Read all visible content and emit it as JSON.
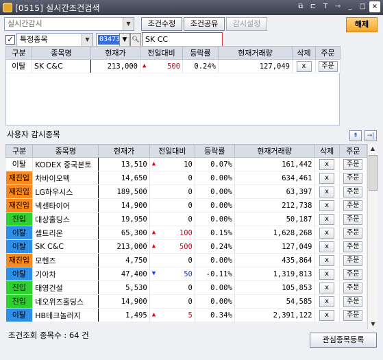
{
  "window": {
    "title": "[0515] 실시간조건검색",
    "controls": [
      "copy-icon",
      "new-window-icon",
      "text-icon",
      "pin-icon",
      "minimize-icon",
      "maximize-icon",
      "close-icon"
    ]
  },
  "toolbar": {
    "condition_select": "실시간감시",
    "edit_condition": "조건수정",
    "share_condition": "조건공유",
    "monitor_settings": "감시설정",
    "release": "해제",
    "stock_scope_select": "특정종목",
    "stock_code": "034730",
    "stock_name": "SK CC",
    "colors": {
      "release_button": "#f5a623",
      "stock_name_border": "#e0384a"
    }
  },
  "grid_headers": [
    "구분",
    "종목명",
    "현재가",
    "전일대비",
    "등락률",
    "현재거래량",
    "삭제",
    "주문"
  ],
  "top_rows": [
    {
      "type": "이탈",
      "tag": "plain",
      "name": "SK C&C",
      "price": "213,000",
      "dir": "up",
      "diff": "500",
      "rate": "0.24%",
      "volume": "127,049",
      "delete": "x",
      "order": "주문"
    }
  ],
  "watch": {
    "label": "사용자 감시종목",
    "rows": [
      {
        "type": "이탈",
        "tag": "plain",
        "name": "KODEX 중국본토",
        "price": "13,510",
        "dir": "up-plain",
        "diff": "10",
        "rate": "0.07%",
        "volume": "161,442",
        "delete": "x",
        "order": "주문"
      },
      {
        "type": "재진입",
        "tag": "reentry",
        "name": "차바이오텍",
        "price": "14,650",
        "dir": "",
        "diff": "0",
        "rate": "0.00%",
        "volume": "634,461",
        "delete": "x",
        "order": "주문"
      },
      {
        "type": "재진입",
        "tag": "reentry",
        "name": "LG하우시스",
        "price": "189,500",
        "dir": "",
        "diff": "0",
        "rate": "0.00%",
        "volume": "63,397",
        "delete": "x",
        "order": "주문"
      },
      {
        "type": "재진입",
        "tag": "reentry",
        "name": "넥센타이어",
        "price": "14,900",
        "dir": "",
        "diff": "0",
        "rate": "0.00%",
        "volume": "212,738",
        "delete": "x",
        "order": "주문"
      },
      {
        "type": "진입",
        "tag": "entry",
        "name": "대상홀딩스",
        "price": "19,950",
        "dir": "",
        "diff": "0",
        "rate": "0.00%",
        "volume": "50,187",
        "delete": "x",
        "order": "주문"
      },
      {
        "type": "이탈",
        "tag": "exit",
        "name": "셀트리온",
        "price": "65,300",
        "dir": "up",
        "diff": "100",
        "rate": "0.15%",
        "volume": "1,628,268",
        "delete": "x",
        "order": "주문"
      },
      {
        "type": "이탈",
        "tag": "exit",
        "name": "SK C&C",
        "price": "213,000",
        "dir": "up",
        "diff": "500",
        "rate": "0.24%",
        "volume": "127,049",
        "delete": "x",
        "order": "주문"
      },
      {
        "type": "재진입",
        "tag": "reentry",
        "name": "모헨즈",
        "price": "4,750",
        "dir": "",
        "diff": "0",
        "rate": "0.00%",
        "volume": "435,864",
        "delete": "x",
        "order": "주문"
      },
      {
        "type": "이탈",
        "tag": "exit",
        "name": "기아차",
        "price": "47,400",
        "dir": "down",
        "diff": "50",
        "rate": "-0.11%",
        "volume": "1,319,813",
        "delete": "x",
        "order": "주문"
      },
      {
        "type": "진입",
        "tag": "entry",
        "name": "태영건설",
        "price": "5,530",
        "dir": "",
        "diff": "0",
        "rate": "0.00%",
        "volume": "105,853",
        "delete": "x",
        "order": "주문"
      },
      {
        "type": "진입",
        "tag": "entry",
        "name": "네오위즈홀딩스",
        "price": "14,900",
        "dir": "",
        "diff": "0",
        "rate": "0.00%",
        "volume": "54,585",
        "delete": "x",
        "order": "주문"
      },
      {
        "type": "이탈",
        "tag": "exit",
        "name": "HB테크놀러지",
        "price": "1,495",
        "dir": "up",
        "diff": "5",
        "rate": "0.34%",
        "volume": "2,391,122",
        "delete": "x",
        "order": "주문"
      }
    ]
  },
  "footer": {
    "count_text": "조건조회 종목수 : 64 건",
    "register_button": "관심종목등록"
  }
}
